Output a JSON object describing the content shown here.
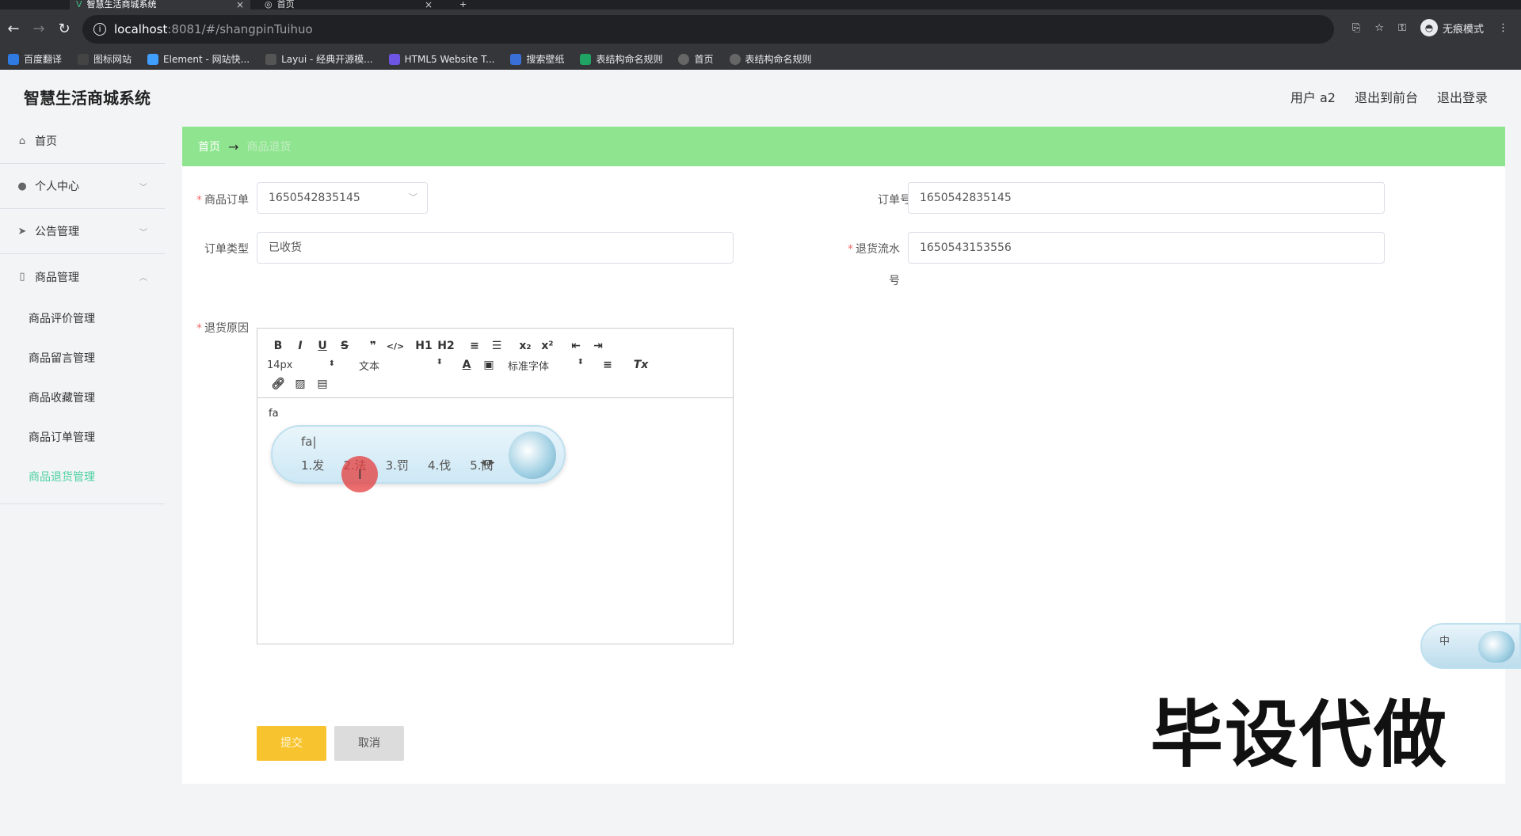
{
  "browser": {
    "tabs": [
      {
        "title": "智慧生活商城系统",
        "active": true
      },
      {
        "title": "首页",
        "active": false
      }
    ],
    "url_host": "localhost",
    "url_path": ":8081/#/shangpinTuihuo",
    "incognito_label": "无痕模式",
    "bookmarks": [
      {
        "label": "百度翻译",
        "color": "#2e7be4"
      },
      {
        "label": "图标网站",
        "color": "#444444"
      },
      {
        "label": "Element - 网站快...",
        "color": "#409eff"
      },
      {
        "label": "Layui - 经典开源模...",
        "color": "#555555"
      },
      {
        "label": "HTML5 Website T...",
        "color": "#6e55e6"
      },
      {
        "label": "搜索壁纸",
        "color": "#3a6fd8"
      },
      {
        "label": "表结构命名规则",
        "color": "#1fa463"
      },
      {
        "label": "首页",
        "color": "#666666"
      },
      {
        "label": "表结构命名规则",
        "color": "#666666"
      }
    ]
  },
  "app": {
    "title": "智慧生活商城系统",
    "header_links": [
      "用户 a2",
      "退出到前台",
      "退出登录"
    ]
  },
  "sidebar": {
    "items": [
      {
        "label": "首页",
        "icon": "home-icon"
      },
      {
        "label": "个人中心",
        "icon": "user-icon"
      },
      {
        "label": "公告管理",
        "icon": "send-icon"
      },
      {
        "label": "商品管理",
        "icon": "phone-icon"
      }
    ],
    "sub_items": [
      "商品评价管理",
      "商品留言管理",
      "商品收藏管理",
      "商品订单管理",
      "商品退货管理"
    ],
    "active_sub": "商品退货管理"
  },
  "breadcrumb": {
    "home": "首页",
    "arrow": "→",
    "current": "商品退货"
  },
  "form": {
    "order_label": "商品订单",
    "order_value": "1650542835145",
    "order_no_label": "订单号",
    "order_no_value": "1650542835145",
    "order_type_label": "订单类型",
    "order_type_value": "已收货",
    "return_serial_label_1": "退货流水",
    "return_serial_label_2": "号",
    "return_serial_value": "1650543153556",
    "reason_label": "退货原因",
    "editor_text": "fa"
  },
  "editor_toolbar": {
    "row1": [
      "B",
      "I",
      "U",
      "S",
      "❞",
      "</>",
      "H1",
      "H2",
      "≡",
      "☰",
      "x₂",
      "x²",
      "⇤",
      "⇥"
    ],
    "size": "14px",
    "header": "文本",
    "font": "标准字体",
    "align": "≡",
    "clean": "Tx"
  },
  "ime": {
    "composition": "fa|",
    "candidates": [
      "1.发",
      "2.法",
      "3.罚",
      "4.伐",
      "5.阀"
    ],
    "mini_label": "中"
  },
  "buttons": {
    "submit": "提交",
    "cancel": "取消"
  },
  "watermark": "毕设代做"
}
